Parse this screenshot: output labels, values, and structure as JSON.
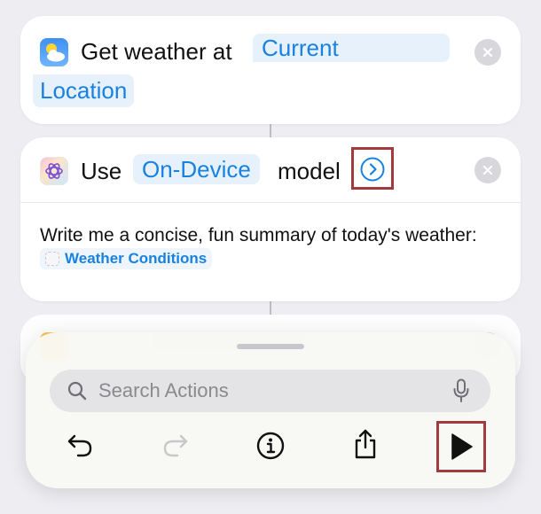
{
  "weather_action": {
    "label": "Get weather at",
    "location_token_line1": "Current",
    "location_token_line2": "Location"
  },
  "model_action": {
    "label_use": "Use",
    "model_token": "On-Device",
    "label_model": "model",
    "prompt_text": "Write me a concise, fun summary of today's weather:",
    "variable_token": "Weather Conditions"
  },
  "search": {
    "placeholder": "Search Actions"
  },
  "toolbar": {
    "items": [
      "undo-icon",
      "redo-icon",
      "info-icon",
      "share-icon",
      "play-icon"
    ]
  },
  "colors": {
    "accent": "#1982e0",
    "token_bg": "#e6f1fc",
    "highlight": "#a23a3e",
    "background": "#ededf2"
  }
}
